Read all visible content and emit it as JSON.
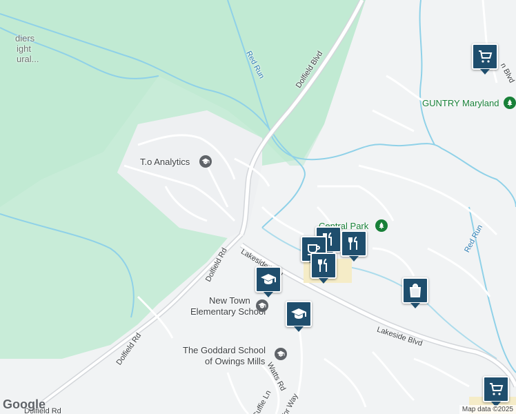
{
  "labels": {
    "dolfield_blvd": "Dolfield Blvd",
    "red_run_1": "Red Run",
    "red_run_2": "Red Run",
    "lakeside_blvd_1": "Lakeside Blvd",
    "lakeside_blvd_2": "Lakeside Blvd",
    "dolfield_rd_1": "Dolfield Rd",
    "dolfield_rd_2": "Dolfield Rd",
    "dolfield_rd_3": "Dolfield Rd",
    "watts_rd": "Watts Rd",
    "cuffie_ln": "Cuffie Ln",
    "tor_way": "Tor Way",
    "soldiers_1": "diers",
    "soldiers_2": "ight",
    "soldiers_3": "ural...",
    "bm_blvd": "n Blvd"
  },
  "pois": {
    "to_analytics": "T.o Analytics",
    "central_park": "Central Park",
    "guntry": "GUNTRY Maryland",
    "new_town_1": "New Town",
    "new_town_2": "Elementary School",
    "goddard_1": "The Goddard School",
    "goddard_2": "of Owings Mills"
  },
  "markers": [
    {
      "type": "shopping-cart"
    },
    {
      "type": "restaurant"
    },
    {
      "type": "cafe"
    },
    {
      "type": "restaurant"
    },
    {
      "type": "restaurant"
    },
    {
      "type": "school"
    },
    {
      "type": "school"
    },
    {
      "type": "shopping-bag"
    },
    {
      "type": "shopping-cart"
    }
  ],
  "footer": {
    "logo": "Google",
    "attribution": "Map data ©2025"
  },
  "colors": {
    "park": "#c8ecd8",
    "park_light": "#d9f2e4",
    "water": "#8fd1e8",
    "road": "#ffffff",
    "major_road": "#dcdfe3",
    "marker": "#1f4e6d"
  }
}
